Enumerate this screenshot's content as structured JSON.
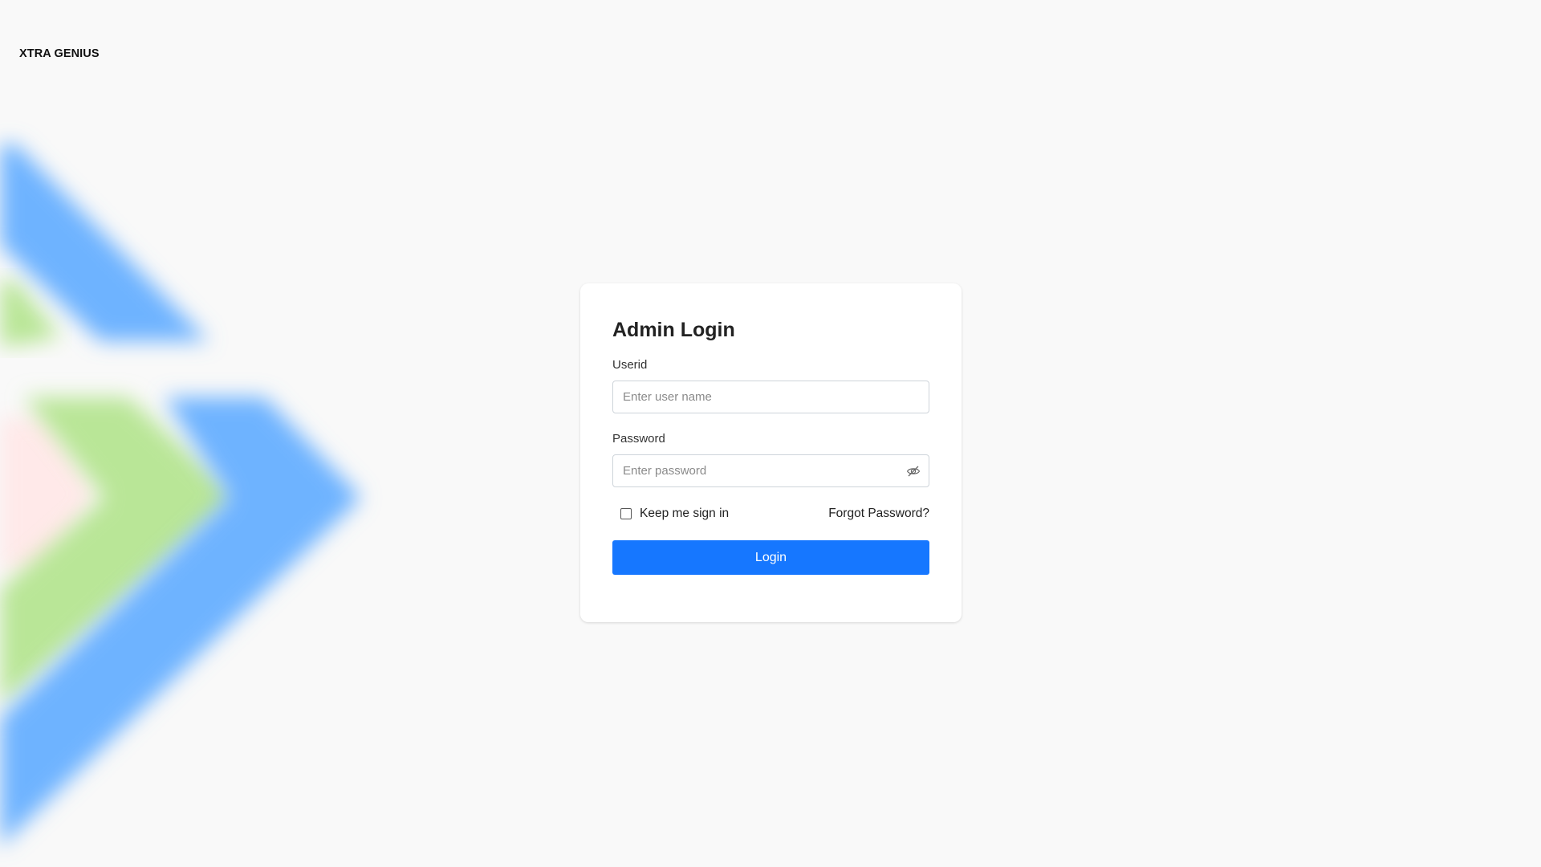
{
  "brand": {
    "name": "XTRA GENIUS"
  },
  "login": {
    "title": "Admin Login",
    "userid_label": "Userid",
    "userid_placeholder": "Enter user name",
    "userid_value": "",
    "password_label": "Password",
    "password_placeholder": "Enter password",
    "password_value": "",
    "password_toggle_icon": "eye-slash-icon",
    "keep_signed_in_label": "Keep me sign in",
    "keep_signed_in_checked": false,
    "forgot_password_label": "Forgot Password?",
    "login_button_label": "Login"
  },
  "colors": {
    "primary": "#1677ff",
    "background": "#f9f9f9",
    "decor_blue": "#6eb3ff",
    "decor_green": "#b9e697",
    "decor_pink": "#ffe9e9"
  }
}
